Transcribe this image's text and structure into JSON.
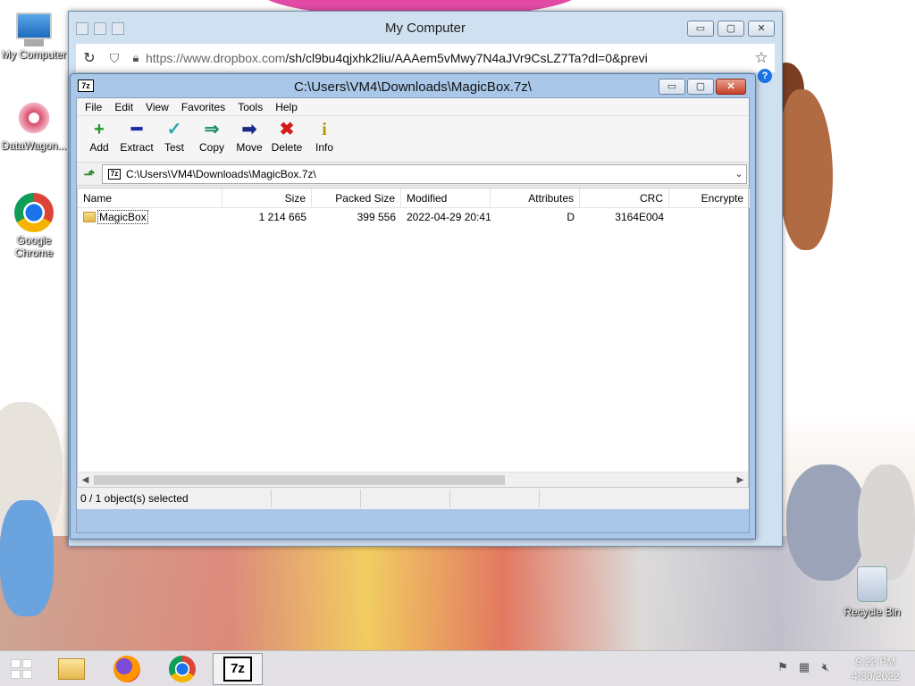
{
  "desktop": {
    "icons": [
      {
        "label": "My Computer"
      },
      {
        "label": "DataWagon..."
      },
      {
        "label": "Google Chrome"
      },
      {
        "label": "Recycle Bin"
      }
    ]
  },
  "browser_window": {
    "title": "My Computer",
    "url_domain": "https://www.dropbox.com",
    "url_rest": "/sh/cl9bu4qjxhk2liu/AAAem5vMwy7N4aJVr9CsLZ7Ta?dl=0&previ",
    "buttons": {
      "minimize": "▭",
      "maximize": "▢",
      "close": "✕"
    }
  },
  "sevenzip": {
    "logo": "7z",
    "title": "C:\\Users\\VM4\\Downloads\\MagicBox.7z\\",
    "menu": [
      "File",
      "Edit",
      "View",
      "Favorites",
      "Tools",
      "Help"
    ],
    "toolbar": [
      {
        "label": "Add",
        "icon": "+",
        "color": "#1a9a1a"
      },
      {
        "label": "Extract",
        "icon": "━",
        "color": "#1c2aa8"
      },
      {
        "label": "Test",
        "icon": "✓",
        "color": "#2aa6b0"
      },
      {
        "label": "Copy",
        "icon": "⇒",
        "color": "#1a8a6a"
      },
      {
        "label": "Move",
        "icon": "➡",
        "color": "#1a2a8a"
      },
      {
        "label": "Delete",
        "icon": "✖",
        "color": "#d41a1a"
      },
      {
        "label": "Info",
        "icon": "i",
        "color": "#b89a00"
      }
    ],
    "path": "C:\\Users\\VM4\\Downloads\\MagicBox.7z\\",
    "columns": {
      "name": "Name",
      "size": "Size",
      "packed": "Packed Size",
      "modified": "Modified",
      "attributes": "Attributes",
      "crc": "CRC",
      "encrypted": "Encrypte"
    },
    "rows": [
      {
        "name": "MagicBox",
        "size": "1 214 665",
        "packed": "399 556",
        "modified": "2022-04-29 20:41",
        "attributes": "D",
        "crc": "3164E004",
        "encrypted": ""
      }
    ],
    "status": "0 / 1 object(s) selected"
  },
  "taskbar": {
    "clock_time": "9:22 PM",
    "clock_date": "4/30/2022",
    "seven_zip_label": "7z"
  }
}
